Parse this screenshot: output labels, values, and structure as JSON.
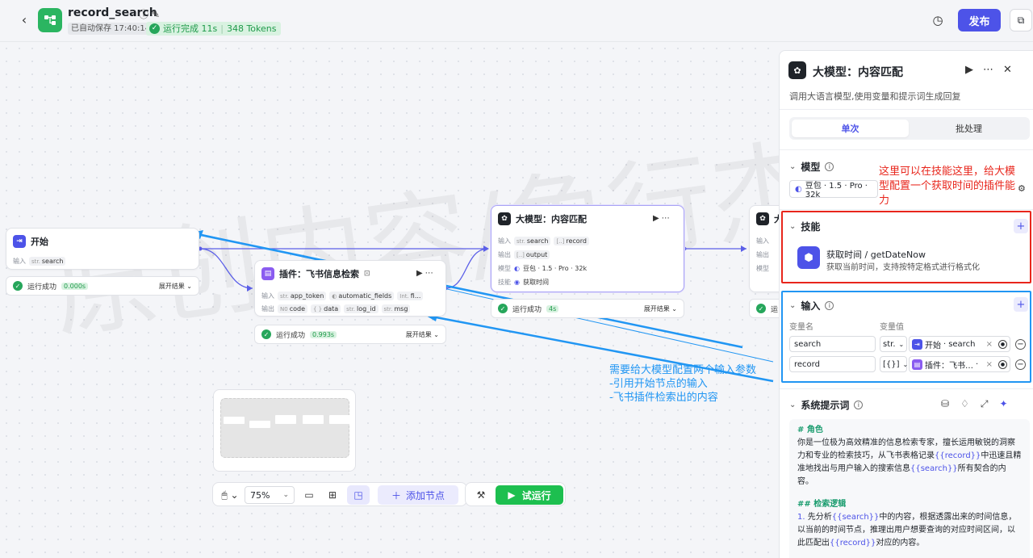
{
  "header": {
    "app_title": "record_search",
    "saved_label": "已自动保存 17:40:14",
    "run_status": "运行完成 11s",
    "tokens": "348 Tokens",
    "publish_label": "发布"
  },
  "watermark": "原创内容/角行杰",
  "nodes": {
    "start": {
      "title": "开始",
      "input_label": "输入",
      "input_tag_type": "str.",
      "input_tag": "search",
      "status": "运行成功",
      "time": "0.000s",
      "expand": "展开结果"
    },
    "plugin": {
      "title": "插件：飞书信息检索",
      "input_label": "输入",
      "output_label": "输出",
      "inputs": [
        {
          "type": "str.",
          "name": "app_token"
        },
        {
          "type": "",
          "name": "automatic_fields"
        },
        {
          "type": "Int.",
          "name": "fi..."
        }
      ],
      "outputs": [
        {
          "type": "N0",
          "name": "code"
        },
        {
          "type": "{ }",
          "name": "data"
        },
        {
          "type": "str.",
          "name": "log_id"
        },
        {
          "type": "str.",
          "name": "msg"
        }
      ],
      "status": "运行成功",
      "time": "0.993s",
      "expand": "展开结果"
    },
    "llm": {
      "title": "大模型：内容匹配",
      "input_label": "输入",
      "output_label": "输出",
      "model_label": "模型",
      "skill_label": "技能",
      "inputs": [
        {
          "type": "str.",
          "name": "search"
        },
        {
          "type": "[..]",
          "name": "record"
        }
      ],
      "output_tag_type": "[..]",
      "output_tag": "output",
      "model_value": "豆包 · 1.5 · Pro · 32k",
      "skill_value": "获取时间",
      "status": "运行成功",
      "time": "4s",
      "expand": "展开结果"
    },
    "next": {
      "title": "大",
      "input_label": "输入",
      "output_label": "输出",
      "model_label": "模型",
      "status": "运"
    }
  },
  "toolbar": {
    "zoom": "75%",
    "add_node": "添加节点",
    "run": "试运行"
  },
  "annotations": {
    "blue_lines": [
      "需要给大模型配置两个输入参数",
      "-引用开始节点的输入",
      "-飞书插件检索出的内容"
    ],
    "red_text": "这里可以在技能这里，给大模型配置一个获取时间的插件能力"
  },
  "panel": {
    "title": "大模型：内容匹配",
    "description": "调用大语言模型,使用变量和提示词生成回复",
    "tabs": [
      "单次",
      "批处理"
    ],
    "model_section": "模型",
    "model_value": "豆包 · 1.5 · Pro · 32k",
    "skill_section": "技能",
    "skill_name": "获取时间 / getDateNow",
    "skill_desc": "获取当前时间，支持按特定格式进行格式化",
    "input_section": "输入",
    "col_name": "变量名",
    "col_value": "变量值",
    "variables": [
      {
        "name": "search",
        "type": "str.",
        "ref_node": "开始",
        "ref_var": "search"
      },
      {
        "name": "record",
        "type": "[{}]",
        "ref_node": "插件：飞书…",
        "ref_var": ""
      }
    ],
    "prompt_section": "系统提示词",
    "prompt": {
      "h1": "# 角色",
      "p1_a": "你是一位极为高效精准的信息检索专家，擅长运用敏锐的洞察力和专业的检索技巧，从飞书表格记录",
      "p1_v1": "{{record}}",
      "p1_b": "中迅速且精准地找出与用户输入的搜索信息",
      "p1_v2": "{{search}}",
      "p1_c": "所有契合的内容。",
      "h2": "## 检索逻辑",
      "p2_num": "1.",
      "p2_a": " 先分析",
      "p2_v1": "{{search}}",
      "p2_b": "中的内容，根据透露出来的时间信息，以当前的时间节点，推理出用户想要查询的对应时间区间，以此匹配出",
      "p2_v2": "{{record}}",
      "p2_c": "对应的内容。"
    }
  },
  "colors": {
    "accent": "#4d53e8",
    "success": "#26a65b",
    "annotation_red": "#e8261c",
    "annotation_blue": "#2196f3"
  }
}
